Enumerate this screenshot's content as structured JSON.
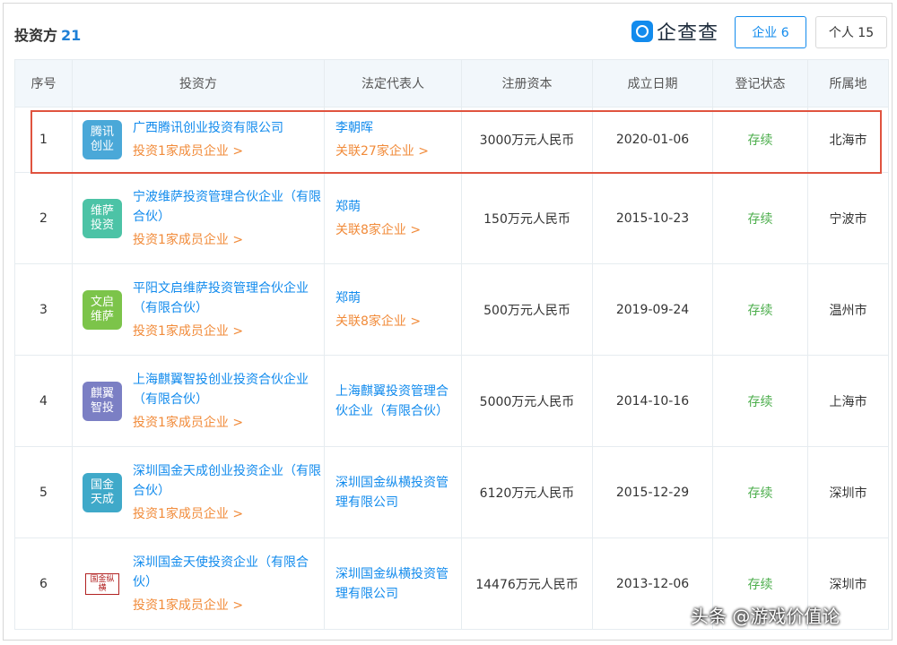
{
  "header": {
    "title": "投资方",
    "count": "21",
    "logo_name": "企查查",
    "tabs": [
      {
        "label": "企业 6"
      },
      {
        "label": "个人 15"
      }
    ]
  },
  "table": {
    "columns": [
      "序号",
      "投资方",
      "法定代表人",
      "注册资本",
      "成立日期",
      "登记状态",
      "所属地"
    ],
    "rows": [
      {
        "index": "1",
        "avatar_text": "腾讯创业",
        "avatar_color": "#4aa8d8",
        "investor": "广西腾讯创业投资有限公司",
        "investor_sub": "投资1家成员企业",
        "legal_rep": "李朝晖",
        "legal_sub": "关联27家企业",
        "capital": "3000万元人民币",
        "date": "2020-01-06",
        "status": "存续",
        "region": "北海市"
      },
      {
        "index": "2",
        "avatar_text": "维萨投资",
        "avatar_color": "#4cc3a6",
        "investor": "宁波维萨投资管理合伙企业（有限合伙）",
        "investor_sub": "投资1家成员企业",
        "legal_rep": "郑萌",
        "legal_sub": "关联8家企业",
        "capital": "150万元人民币",
        "date": "2015-10-23",
        "status": "存续",
        "region": "宁波市"
      },
      {
        "index": "3",
        "avatar_text": "文启维萨",
        "avatar_color": "#7cc44a",
        "investor": "平阳文启维萨投资管理合伙企业（有限合伙）",
        "investor_sub": "投资1家成员企业",
        "legal_rep": "郑萌",
        "legal_sub": "关联8家企业",
        "capital": "500万元人民币",
        "date": "2019-09-24",
        "status": "存续",
        "region": "温州市"
      },
      {
        "index": "4",
        "avatar_text": "麒翼智投",
        "avatar_color": "#7b7fc4",
        "investor": "上海麒翼智投创业投资合伙企业（有限合伙）",
        "investor_sub": "投资1家成员企业",
        "legal_rep": "上海麒翼投资管理合伙企业（有限合伙）",
        "legal_sub": "",
        "capital": "5000万元人民币",
        "date": "2014-10-16",
        "status": "存续",
        "region": "上海市"
      },
      {
        "index": "5",
        "avatar_text": "国金天成",
        "avatar_color": "#3fa9c9",
        "investor": "深圳国金天成创业投资企业（有限合伙）",
        "investor_sub": "投资1家成员企业",
        "legal_rep": "深圳国金纵横投资管理有限公司",
        "legal_sub": "",
        "capital": "6120万元人民币",
        "date": "2015-12-29",
        "status": "存续",
        "region": "深圳市"
      },
      {
        "index": "6",
        "avatar_text": "国金纵横",
        "avatar_color": "#ffffff",
        "investor": "深圳国金天使投资企业（有限合伙）",
        "investor_sub": "投资1家成员企业",
        "legal_rep": "深圳国金纵横投资管理有限公司",
        "legal_sub": "",
        "capital": "14476万元人民币",
        "date": "2013-12-06",
        "status": "存续",
        "region": "深圳市"
      }
    ]
  },
  "watermark": "头条 @游戏价值论"
}
